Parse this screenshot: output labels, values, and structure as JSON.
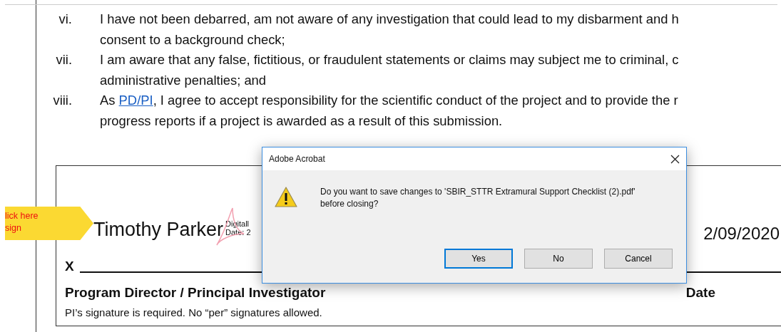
{
  "document": {
    "items": [
      {
        "numeral": "vi.",
        "lines": [
          "I have not been debarred, am not aware of any investigation that could lead to my disbarment and h",
          "consent to a background check;"
        ]
      },
      {
        "numeral": "vii.",
        "lines": [
          "I am aware that any false, fictitious, or fraudulent statements or claims may subject me to criminal, c",
          "administrative penalties; and"
        ]
      },
      {
        "numeral": "viii.",
        "lead": "As ",
        "link": "PD/PI",
        "lines": [
          ", I agree to accept responsibility for the scientific conduct of the project and to provide the r",
          "progress reports if a project is awarded as a result of this submission."
        ]
      }
    ],
    "signature": {
      "tag": [
        "lick here",
        "sign"
      ],
      "signer": "Timothy Parker",
      "details": [
        "Digitall",
        "Date: 2"
      ],
      "date": "2/09/2020",
      "x_mark": "X",
      "role": "Program Director / Principal Investigator",
      "date_label": "Date",
      "note": "PI’s signature is required. No “per” signatures allowed."
    }
  },
  "dialog": {
    "title": "Adobe Acrobat",
    "message": [
      "Do you want to save changes to 'SBIR_STTR Extramural Support Checklist (2).pdf'",
      "before closing?"
    ],
    "buttons": [
      {
        "label": "Yes",
        "selected": true
      },
      {
        "label": "No",
        "selected": false
      },
      {
        "label": "Cancel",
        "selected": false
      }
    ]
  }
}
